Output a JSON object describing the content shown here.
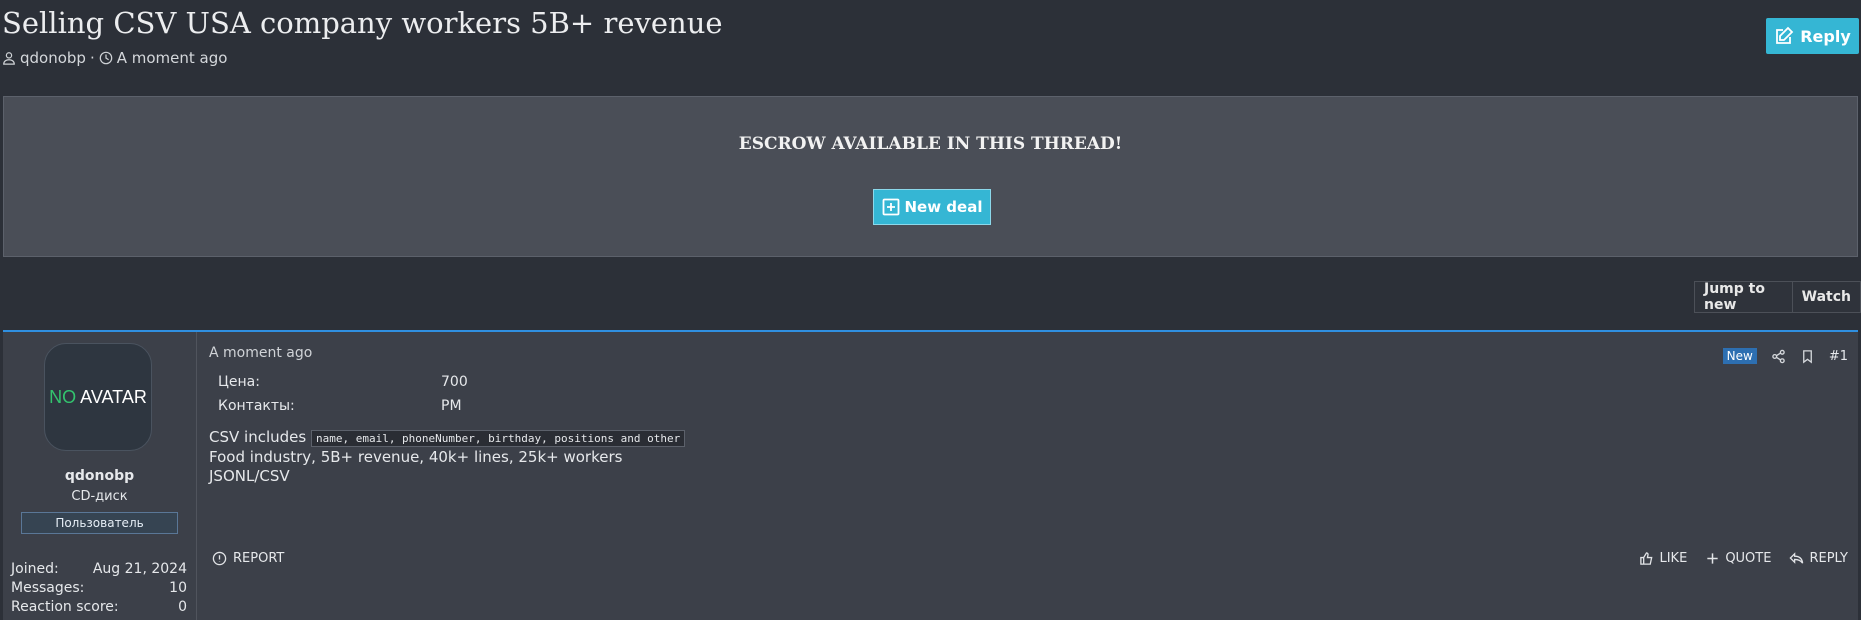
{
  "thread": {
    "title": "Selling CSV USA company workers 5B+ revenue",
    "author": "qdonobp",
    "separator": "·",
    "time": "A moment ago",
    "reply_label": "Reply"
  },
  "escrow": {
    "text": "ESCROW AVAILABLE IN THIS THREAD!",
    "button_label": "New deal"
  },
  "toolbar": {
    "jump_label": "Jump to new",
    "watch_label": "Watch"
  },
  "post": {
    "time": "A moment ago",
    "new_badge": "New",
    "number": "#1",
    "fields": [
      {
        "key": "Цена:",
        "value": "700"
      },
      {
        "key": "Контакты:",
        "value": "PM"
      }
    ],
    "line1_prefix": "CSV includes",
    "line1_code": "name, email, phoneNumber, birthday, positions and other",
    "line2": "Food industry, 5B+ revenue, 40k+ lines, 25k+ workers",
    "line3": "JSONL/CSV",
    "report_label": "REPORT",
    "like_label": "LIKE",
    "quote_label": "QUOTE",
    "reply_label": "REPLY"
  },
  "user": {
    "avatar_no": "NO",
    "avatar_text": "AVATAR",
    "name": "qdonobp",
    "title": "CD-диск",
    "badge": "Пользователь",
    "stats": [
      {
        "label": "Joined:",
        "value": "Aug 21, 2024"
      },
      {
        "label": "Messages:",
        "value": "10"
      },
      {
        "label": "Reaction score:",
        "value": "0"
      }
    ]
  },
  "colors": {
    "accent": "#35b6d4",
    "post_border": "#2f8fe0",
    "background": "#2c3038",
    "no_avatar_green": "#33c46e"
  }
}
